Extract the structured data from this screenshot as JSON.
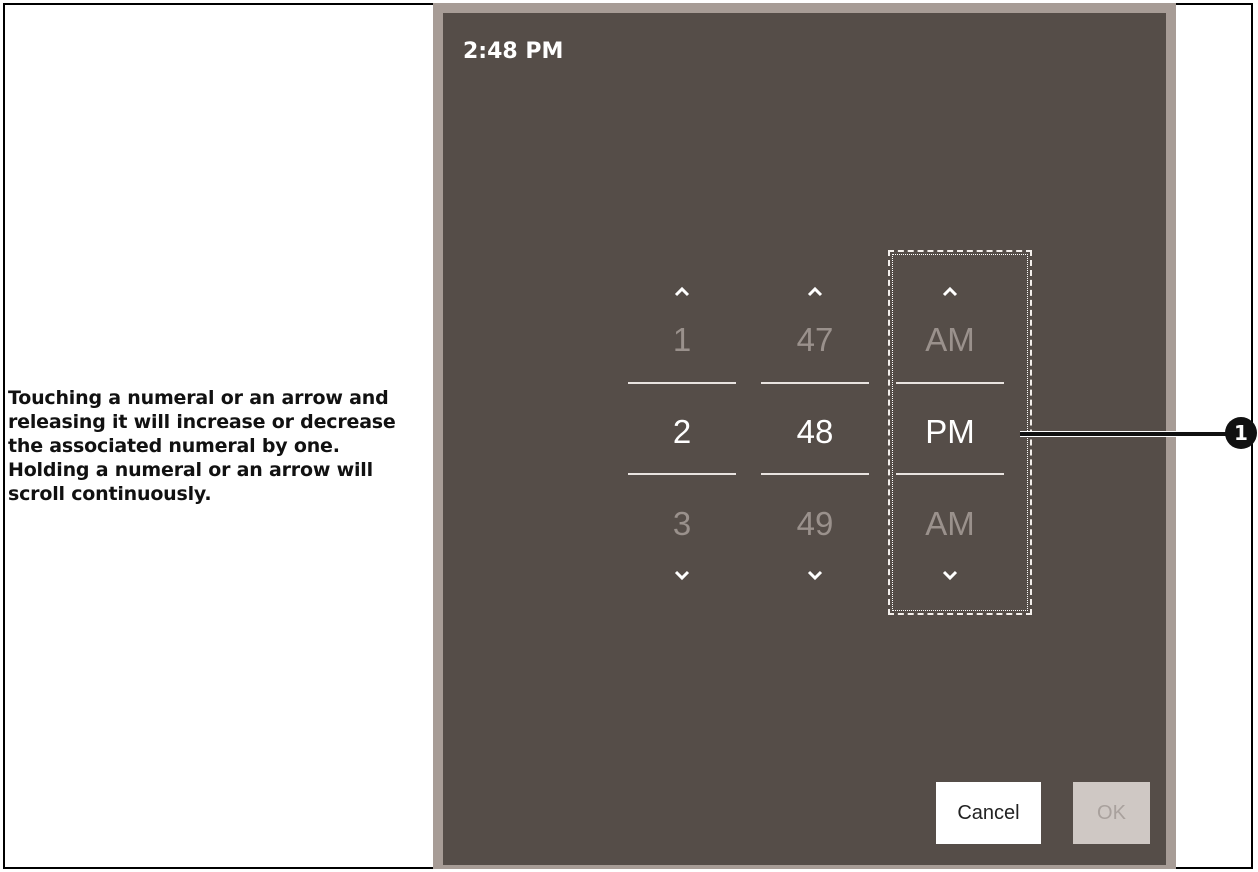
{
  "annotation": {
    "text": "Touching a numeral or an arrow and releasing it will increase or decrease the associated numeral by one. Holding a numeral or an arrow will scroll continuously.",
    "marker": "1"
  },
  "picker": {
    "current_time": "2:48 PM",
    "hour": {
      "prev": "1",
      "current": "2",
      "next": "3"
    },
    "minute": {
      "prev": "47",
      "current": "48",
      "next": "49"
    },
    "period": {
      "prev": "AM",
      "current": "PM",
      "next": "AM"
    }
  },
  "buttons": {
    "cancel": "Cancel",
    "ok": "OK"
  },
  "colors": {
    "screen_bg": "#554d48",
    "bezel": "#a79c96",
    "ok_disabled_bg": "#cfc8c4"
  }
}
